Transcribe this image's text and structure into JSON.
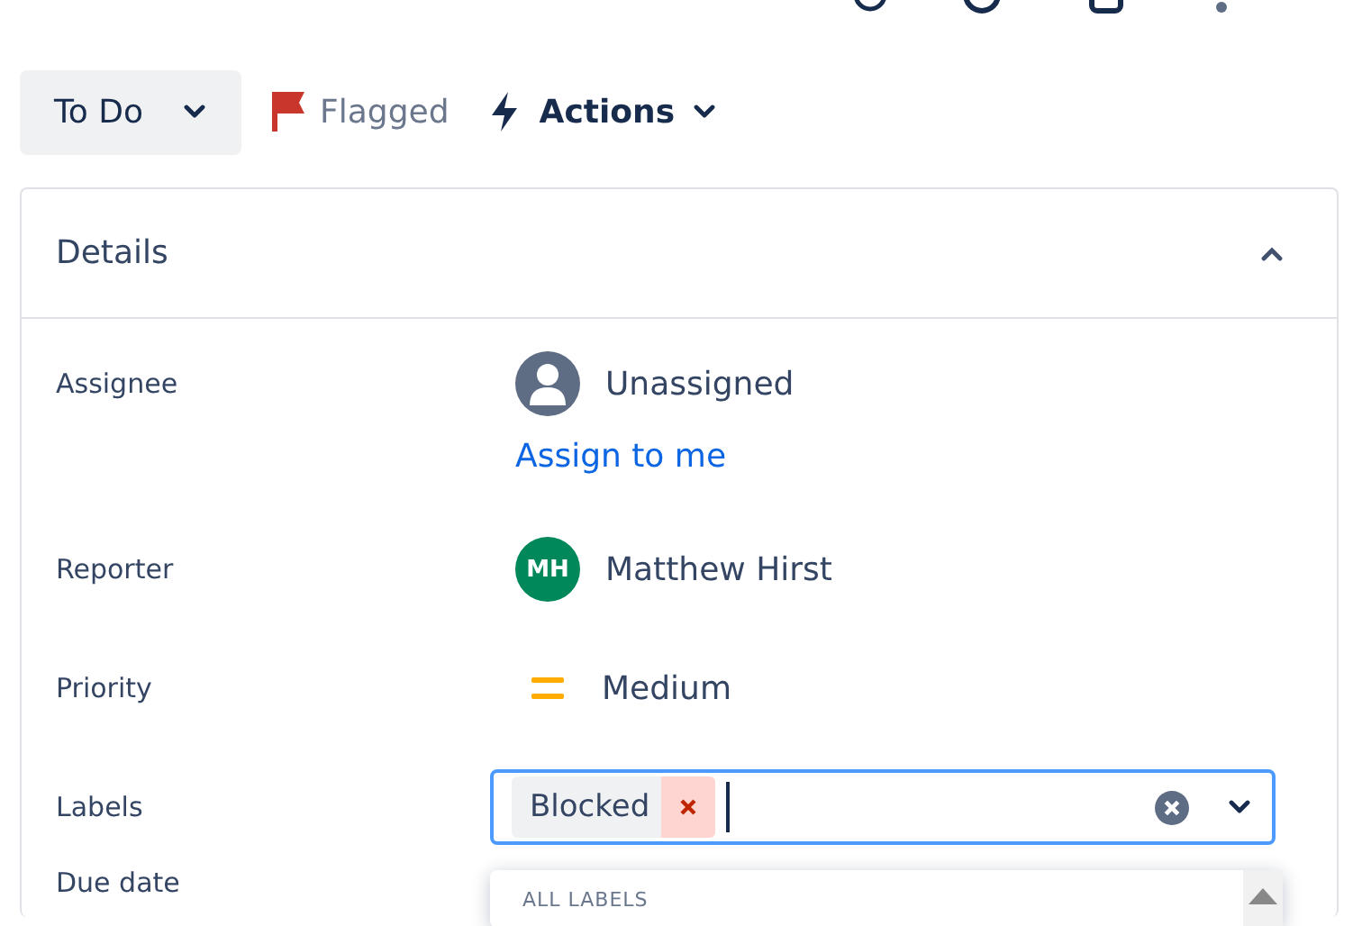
{
  "status_button": {
    "label": "To Do"
  },
  "flag": {
    "label": "Flagged"
  },
  "actions": {
    "label": "Actions"
  },
  "details": {
    "title": "Details",
    "expanded": true,
    "fields": [
      {
        "kind": "user",
        "label": "Assignee",
        "value": "Unassigned",
        "link": "Assign to me"
      },
      {
        "kind": "user",
        "label": "Reporter",
        "value": "Matthew Hirst",
        "avatar": "MH",
        "color": "#00875a"
      },
      {
        "kind": "priority",
        "label": "Priority",
        "value": "Medium"
      },
      {
        "kind": "labels",
        "label": "Labels",
        "tags": [
          "Blocked"
        ],
        "focused": true,
        "menu_heading": "ALL LABELS"
      },
      {
        "kind": "text",
        "label": "Due date"
      }
    ]
  }
}
